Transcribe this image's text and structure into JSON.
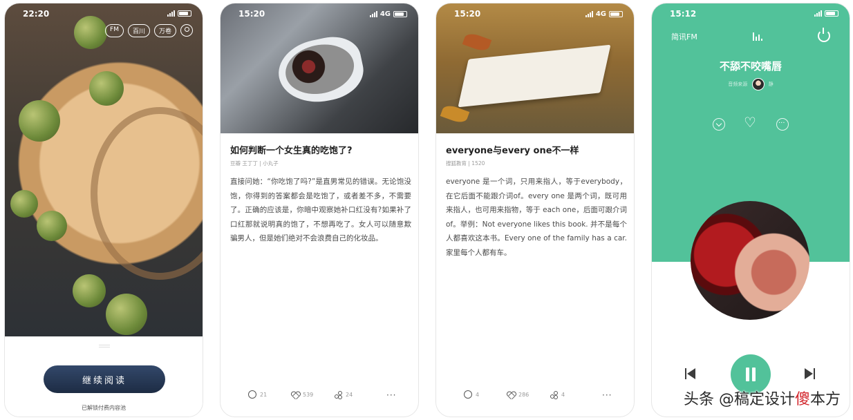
{
  "screens": {
    "reader_home": {
      "status_time": "22:20",
      "top_buttons": [
        "FM",
        "百川",
        "万卷"
      ],
      "read_button": "继续阅读",
      "note": "已解锁付费内容池"
    },
    "article1": {
      "status_time": "15:20",
      "status_net": "4G",
      "title": "如何判断一个女生真的吃饱了?",
      "meta": "豆瓣 王丁丁 | 小丸子",
      "body": "直接问她：“你吃饱了吗?”是直男常见的错误。无论饱没饱，你得到的答案都会是吃饱了，或者差不多，不需要了。正确的应该是，你暗中观察她补口红没有?如果补了口红那就说明真的饱了，不想再吃了。女人可以随意欺骗男人，但是她们绝对不会浪费自己的化妆品。",
      "comments": "21",
      "likes": "539",
      "shares": "24",
      "more": "···"
    },
    "article2": {
      "status_time": "15:20",
      "status_net": "4G",
      "title": "everyone与every one不一样",
      "meta": "搜狐教育 | 1520",
      "body": "everyone 是一个词，只用来指人，等于everybody，在它后面不能跟介词of。every one 是两个词，既可用来指人，也可用来指物，等于 each one，后面可跟介词of。举例：Not everyone likes this book. 并不是每个人都喜欢这本书。Every one of the family has a car. 家里每个人都有车。",
      "comments": "4",
      "likes": "286",
      "shares": "4",
      "more": "···"
    },
    "fm_player": {
      "status_time": "15:12",
      "brand": "简讯FM",
      "track_title": "不舔不咬嘴唇",
      "source": "音频来源",
      "host": "静",
      "accent": "#52c29a"
    }
  },
  "watermark": {
    "prefix": "头条 @稿定设计",
    "highlight": "傻",
    "suffix": "本方"
  }
}
